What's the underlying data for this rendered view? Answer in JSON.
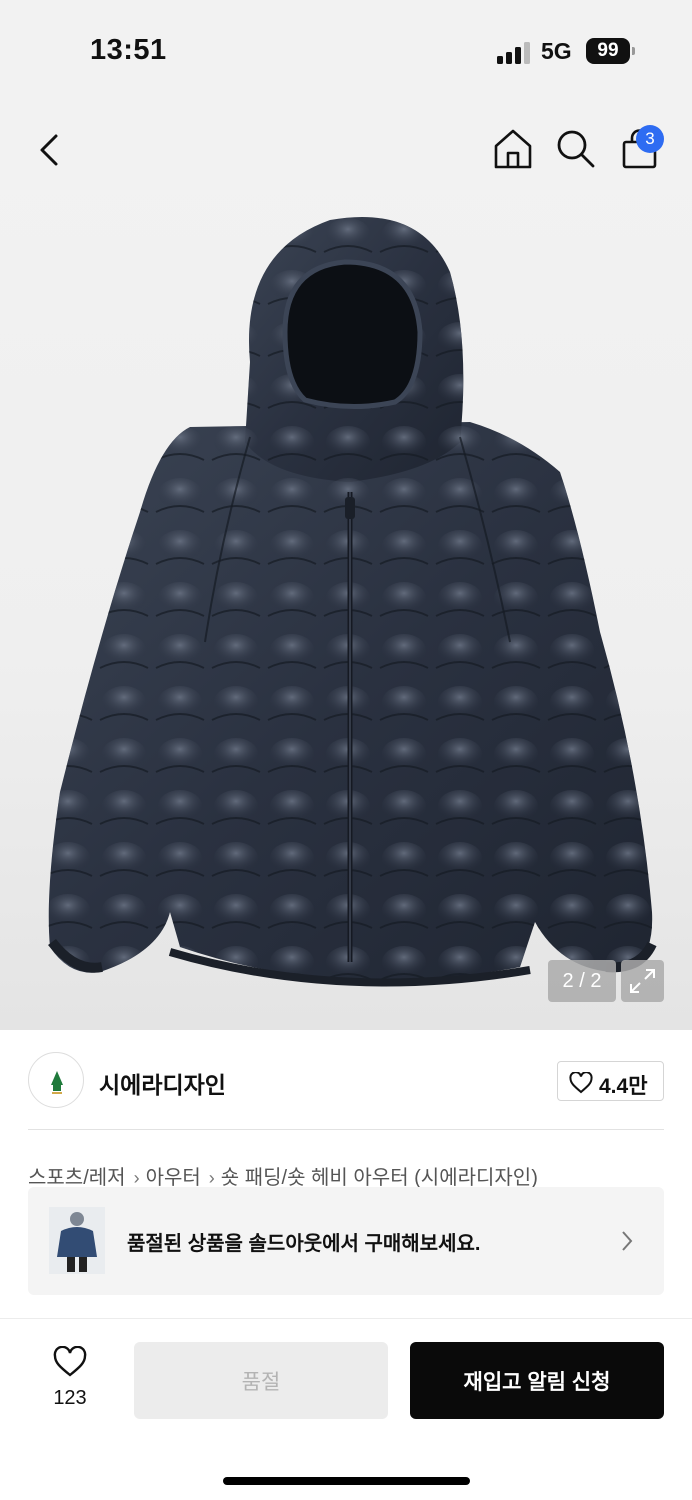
{
  "status_bar": {
    "time": "13:51",
    "network": "5G",
    "battery": "99"
  },
  "header": {
    "back_icon": "chevron-left-icon",
    "home_icon": "home-icon",
    "search_icon": "search-icon",
    "cart_icon": "shopping-bag-icon",
    "cart_count": "3"
  },
  "gallery": {
    "page_indicator": "2 / 2",
    "expand_icon": "expand-icon",
    "product_image": "navy quilted down hooded jacket"
  },
  "brand": {
    "name": "시에라디자인",
    "likes": "4.4만"
  },
  "breadcrumb": [
    "스포츠/레저",
    "아우터",
    "숏 패딩/숏 헤비 아우터 (시에라디자인)"
  ],
  "soldout_banner": {
    "text": "품절된 상품을 솔드아웃에서 구매해보세요."
  },
  "bottom_bar": {
    "wish_count": "123",
    "soldout_label": "품절",
    "restock_label": "재입고 알림 신청"
  },
  "colors": {
    "accent_badge": "#2e6cf2",
    "primary_button": "#0a0a0a",
    "disabled_button": "#ececec"
  }
}
